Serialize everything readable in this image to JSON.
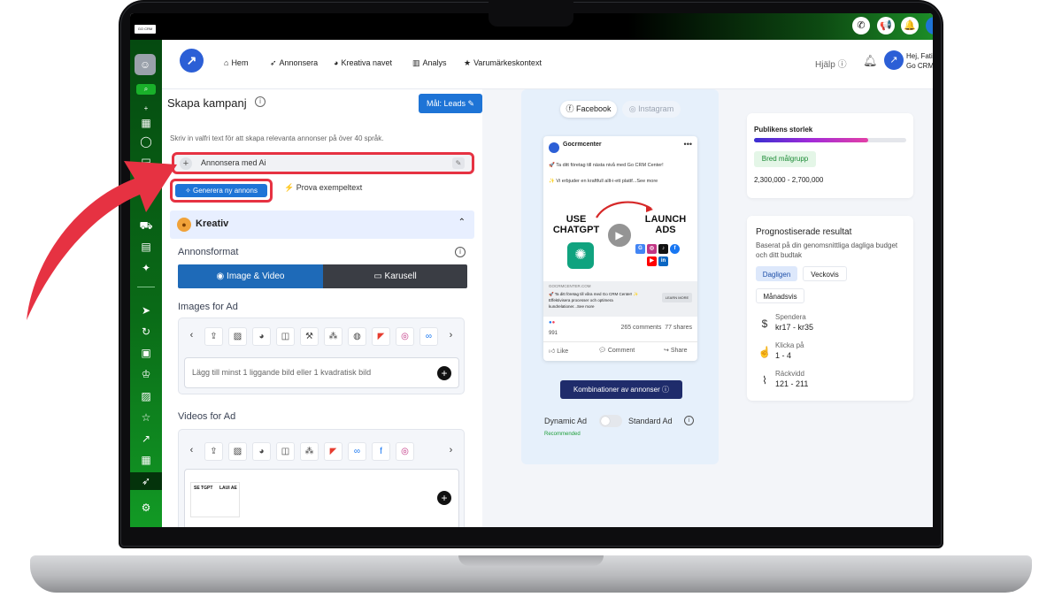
{
  "topbar": {
    "logo_text": "GO CRM",
    "icons": [
      "phone-icon",
      "megaphone-icon",
      "bell-icon"
    ]
  },
  "header": {
    "nav": [
      {
        "label": "Hem",
        "icon": "home-icon"
      },
      {
        "label": "Annonsera",
        "icon": "rocket-icon"
      },
      {
        "label": "Kreativa navet",
        "icon": "palette-icon"
      },
      {
        "label": "Analys",
        "icon": "chart-icon"
      },
      {
        "label": "Varumärkeskontext",
        "icon": "star-icon"
      }
    ],
    "help": "Hjälp",
    "user_line1": "Hej, Fati",
    "user_line2": "Go CRM"
  },
  "campaign": {
    "title": "Skapa kampanj",
    "goal_button": "Mål: Leads",
    "hint": "Skriv in valfri text för att skapa relevanta annonser på över 40 språk.",
    "ai_input_value": "Annonsera med Ai",
    "generate_button": "Generera ny annons",
    "try_example": "Prova exempeltext"
  },
  "creative": {
    "section_title": "Kreativ",
    "format_label": "Annonsformat",
    "format_image": "Image & Video",
    "format_carousel": "Karusell",
    "images_label": "Images for Ad",
    "images_placeholder": "Lägg till minst 1 liggande bild eller 1 kvadratisk bild",
    "videos_label": "Videos for Ad",
    "thumb_text_left": "SE TGPT",
    "thumb_text_right": "LAUI AE"
  },
  "preview": {
    "tab_facebook": "Facebook",
    "tab_instagram": "Instagram",
    "page_name": "Gocrmcenter",
    "text_line1": "🚀 Ta ditt företag till nästa nivå med Go CRM Center!",
    "text_line2": "✨ Vi erbjuder en kraftfull allt-i-ett plattf...See more",
    "image_left": "USE CHATGPT",
    "image_right": "LAUNCH ADS",
    "link_url": "GOCRMCENTER.COM",
    "link_line1": "🚀 Ta ditt företag till våra med Go CRM Center! ✨",
    "link_line2": "Effektivisera processer och optimera",
    "link_line3": "kundrelationer...See more",
    "learn_more": "LEARN MORE",
    "reaction_count": "991",
    "comments": "265 comments",
    "shares": "77 shares",
    "like": "Like",
    "comment": "Comment",
    "share": "Share",
    "combos_button": "Kombinationer av annonser",
    "dynamic_label": "Dynamic Ad",
    "standard_label": "Standard Ad",
    "recommended": "Recommended",
    "dynamic_enabled": false
  },
  "audience": {
    "title": "Publikens storlek",
    "fill_fraction": 0.75,
    "badge": "Bred målgrupp",
    "range": "2,300,000 - 2,700,000"
  },
  "forecast": {
    "title": "Prognostiserade resultat",
    "subtitle": "Baserat på din genomsnittliga dagliga budget och ditt budtak",
    "tabs": [
      "Dagligen",
      "Veckovis",
      "Månadsvis"
    ],
    "active_tab": "Dagligen",
    "metrics": [
      {
        "label": "Spendera",
        "value": "kr17 - kr35",
        "icon": "dollar-icon"
      },
      {
        "label": "Klicka på",
        "value": "1 - 4",
        "icon": "click-icon"
      },
      {
        "label": "Räckvidd",
        "value": "121 - 211",
        "icon": "reach-chart-icon"
      }
    ]
  },
  "colors": {
    "accent_blue": "#1e74d6",
    "highlight_red": "#e63242",
    "sidebar_green": "#0a6a17",
    "success_green": "#1b8a35"
  }
}
